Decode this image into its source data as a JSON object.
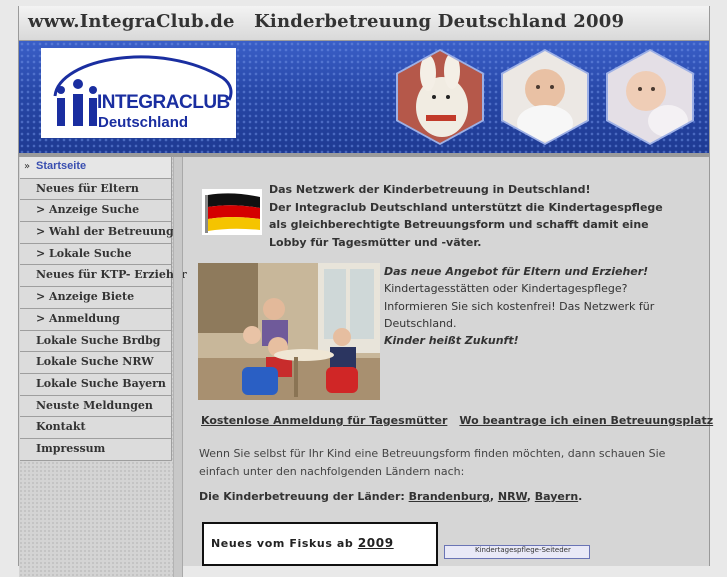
{
  "header": {
    "title": "www.IntegraClub.de   Kinderbetreuung Deutschland 2009"
  },
  "banner": {
    "logo_text_line1": "INTEGRACLUB",
    "logo_text_line2": "Deutschland",
    "colors": {
      "banner": "#2848a8",
      "logo_text": "#1a2ea0"
    }
  },
  "sidebar": {
    "items": [
      {
        "label": "Startseite",
        "active": true
      },
      {
        "label": "Neues für Eltern"
      },
      {
        "label": "> Anzeige Suche"
      },
      {
        "label": "> Wahl der Betreuung"
      },
      {
        "label": "> Lokale Suche"
      },
      {
        "label": "Neues für KTP- Erzieher"
      },
      {
        "label": "> Anzeige Biete"
      },
      {
        "label": ">  Anmeldung"
      },
      {
        "label": "Lokale Suche Brdbg"
      },
      {
        "label": "Lokale Suche NRW"
      },
      {
        "label": "Lokale Suche Bayern"
      },
      {
        "label": "Neuste Meldungen"
      },
      {
        "label": "Kontakt"
      },
      {
        "label": "Impressum"
      }
    ]
  },
  "main": {
    "intro_line1": "Das Netzwerk der Kinderbetreuung in Deutschland!",
    "intro_line2": "Der Integraclub Deutschland unterstützt die Kindertagespflege als gleichberechtigte Betreuungsform und schafft damit eine Lobby für Tagesmütter und -väter.",
    "offer_title": "Das neue Angebot für Eltern und Erzieher!",
    "offer_text": "Kindertagesstätten oder Kindertagespflege? Informieren Sie sich kostenfrei!  Das Netzwerk für Deutschland.",
    "offer_slogan": "Kinder heißt Zukunft!",
    "link_registration": "Kostenlose Anmeldung für Tagesmütter",
    "link_apply": "Wo beantrage ich einen Betreuungsplatz ",
    "paragraph": "Wenn Sie selbst für Ihr Kind eine Betreuungsform finden möchten, dann schauen Sie einfach unter den nachfolgenden Ländern nach:",
    "laender_label": "Die Kinderbetreuung der Länder:",
    "laender": [
      "Brandenburg",
      "NRW",
      "Bayern"
    ],
    "fiskus_text": "Neues vom Fiskus ab ",
    "fiskus_year": "2009",
    "small_box_text": "Kindertagespflege-Seiteder"
  }
}
